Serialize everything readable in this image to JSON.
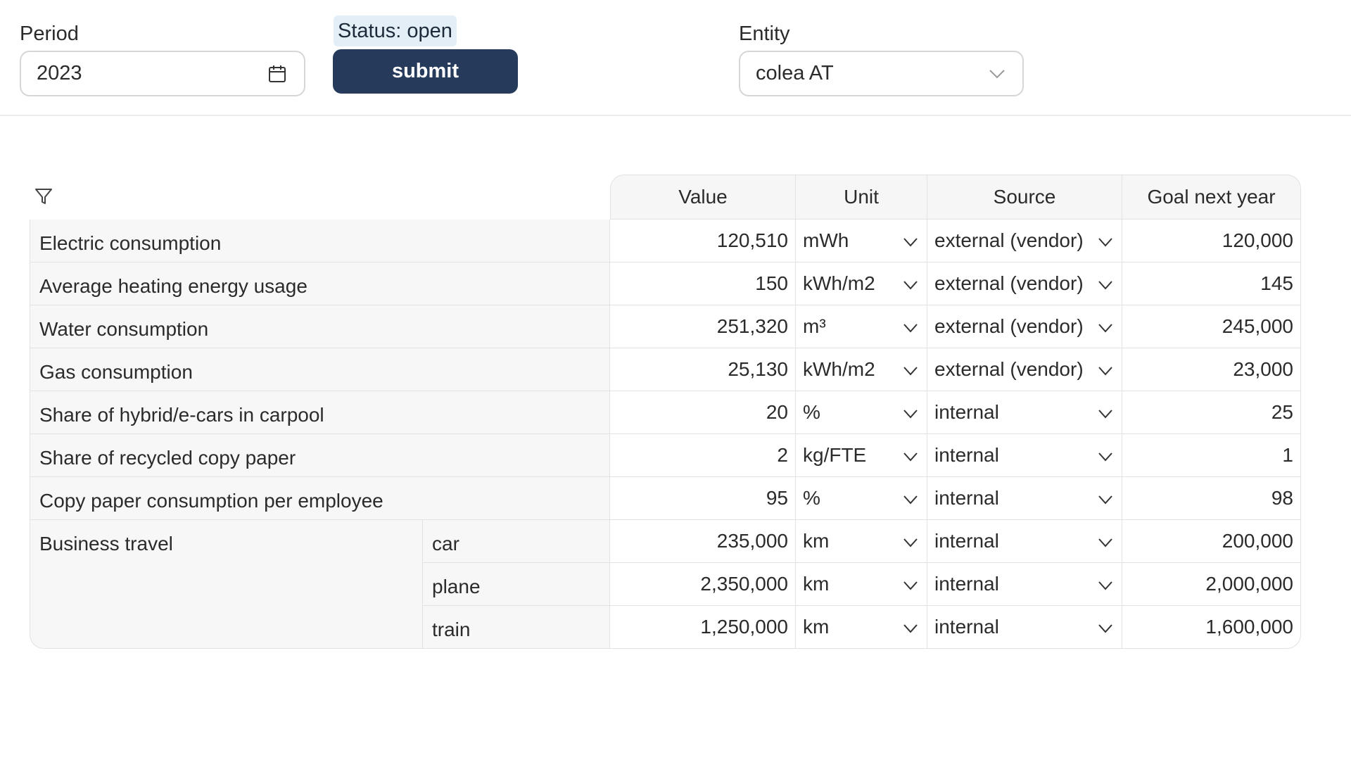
{
  "header": {
    "period": {
      "label": "Period",
      "value": "2023"
    },
    "status": "Status: open",
    "submit_label": "submit",
    "entity": {
      "label": "Entity",
      "value": "colea AT"
    }
  },
  "table": {
    "columns": [
      "Value",
      "Unit",
      "Source",
      "Goal next year"
    ],
    "rows": [
      {
        "label": "Electric consumption",
        "value": "120,510",
        "unit": "mWh",
        "source": "external (vendor)",
        "goal": "120,000"
      },
      {
        "label": "Average heating energy usage",
        "value": "150",
        "unit": "kWh/m2",
        "source": "external (vendor)",
        "goal": "145"
      },
      {
        "label": "Water consumption",
        "value": "251,320",
        "unit": "m³",
        "source": "external (vendor)",
        "goal": "245,000"
      },
      {
        "label": "Gas consumption",
        "value": "25,130",
        "unit": "kWh/m2",
        "source": "external (vendor)",
        "goal": "23,000"
      },
      {
        "label": "Share of hybrid/e-cars in carpool",
        "value": "20",
        "unit": "%",
        "source": "internal",
        "goal": "25"
      },
      {
        "label": "Share of recycled copy paper",
        "value": "2",
        "unit": "kg/FTE",
        "source": "internal",
        "goal": "1"
      },
      {
        "label": "Copy paper consumption per employee",
        "value": "95",
        "unit": "%",
        "source": "internal",
        "goal": "98"
      }
    ],
    "business_travel": {
      "label": "Business travel",
      "rows": [
        {
          "label": "car",
          "value": "235,000",
          "unit": "km",
          "source": "internal",
          "goal": "200,000"
        },
        {
          "label": "plane",
          "value": "2,350,000",
          "unit": "km",
          "source": "internal",
          "goal": "2,000,000"
        },
        {
          "label": "train",
          "value": "1,250,000",
          "unit": "km",
          "source": "internal",
          "goal": "1,600,000"
        }
      ]
    }
  },
  "icons": {
    "calendar": "calendar-icon",
    "chevron": "chevron-down-icon",
    "filter": "filter-icon"
  }
}
